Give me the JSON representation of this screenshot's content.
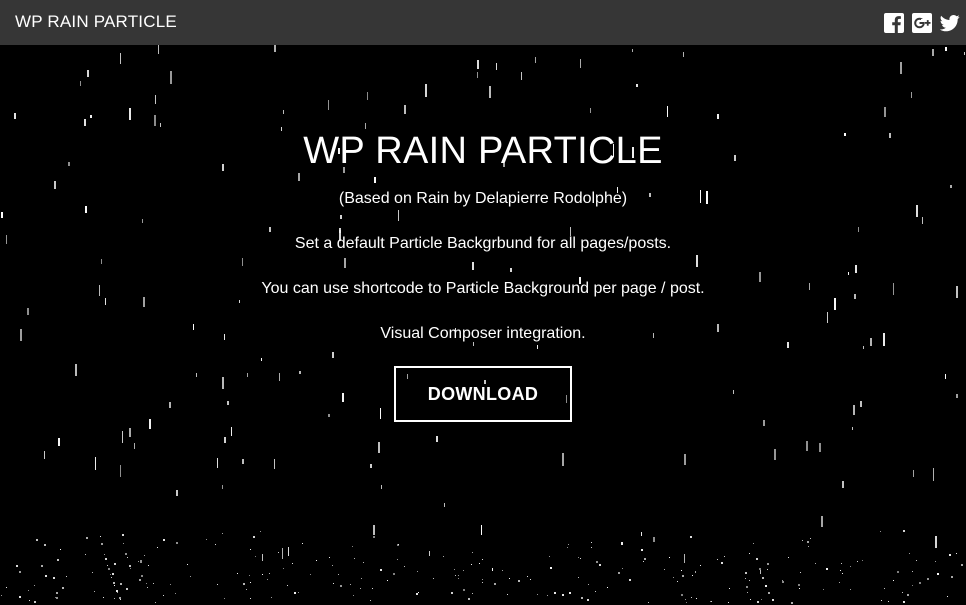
{
  "header": {
    "brand": "WP RAIN PARTICLE",
    "social": [
      {
        "icon": "facebook-icon"
      },
      {
        "icon": "google-plus-icon"
      },
      {
        "icon": "twitter-icon"
      }
    ]
  },
  "hero": {
    "title": "WP RAIN PARTICLE",
    "lines": [
      "(Based on Rain by Delapierre Rodolphe)",
      "Set a default Particle Backgrbund for all pages/posts.",
      "You can use shortcode to Particle Background per page / post.",
      "Visual Composer integration."
    ],
    "button": "DOWNLOAD"
  },
  "colors": {
    "header_bg": "#363636",
    "background": "#000000",
    "text": "#ffffff"
  }
}
